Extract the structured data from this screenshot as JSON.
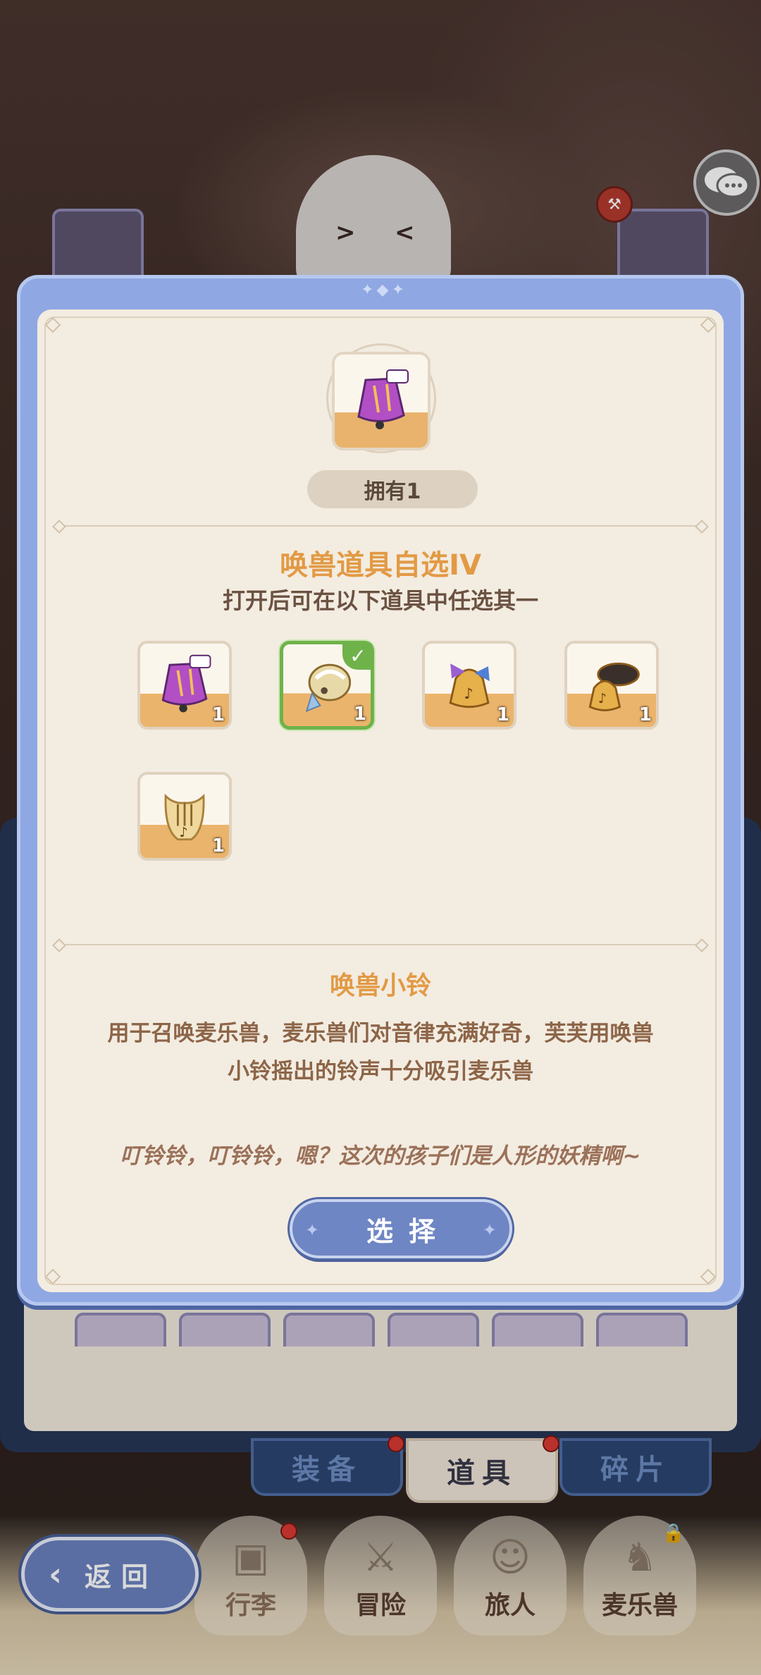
{
  "modal": {
    "owned_label": "拥有1",
    "title": "唤兽道具自选IV",
    "subtitle": "打开后可在以下道具中任选其一",
    "choices": [
      {
        "icon": "purple-bell-icon",
        "qty": "1",
        "selected": false
      },
      {
        "icon": "silver-bell-icon",
        "qty": "1",
        "selected": true
      },
      {
        "icon": "ribbon-bell-icon",
        "qty": "1",
        "selected": false
      },
      {
        "icon": "drum-bell-icon",
        "qty": "1",
        "selected": false
      },
      {
        "icon": "lyre-icon",
        "qty": "1",
        "selected": false
      }
    ],
    "detail_title": "唤兽小铃",
    "detail_line1": "用于召唤麦乐兽，麦乐兽们对音律充满好奇，芙芙用唤兽",
    "detail_line2": "小铃摇出的铃声十分吸引麦乐兽",
    "flavor": "叮铃铃，叮铃铃，嗯？这次的孩子们是人形的妖精啊~",
    "select_label": "选择"
  },
  "bag_tabs": [
    {
      "label": "装备",
      "badge": true
    },
    {
      "label": "道具",
      "badge": true,
      "active": true
    },
    {
      "label": "碎片",
      "badge": false
    }
  ],
  "bottom_nav": {
    "back_label": "返回",
    "items": [
      {
        "label": "行李",
        "icon": "suitcase-icon",
        "badge": true
      },
      {
        "label": "冒险",
        "icon": "crossed-swords-icon",
        "badge": false
      },
      {
        "label": "旅人",
        "icon": "traveler-icon",
        "badge": false
      },
      {
        "label": "麦乐兽",
        "icon": "beast-icon",
        "badge": false,
        "locked": true
      }
    ]
  },
  "colors": {
    "accent_orange": "#e29a45",
    "modal_blue": "#8fa8e3",
    "selected_green": "#6fb24a"
  }
}
